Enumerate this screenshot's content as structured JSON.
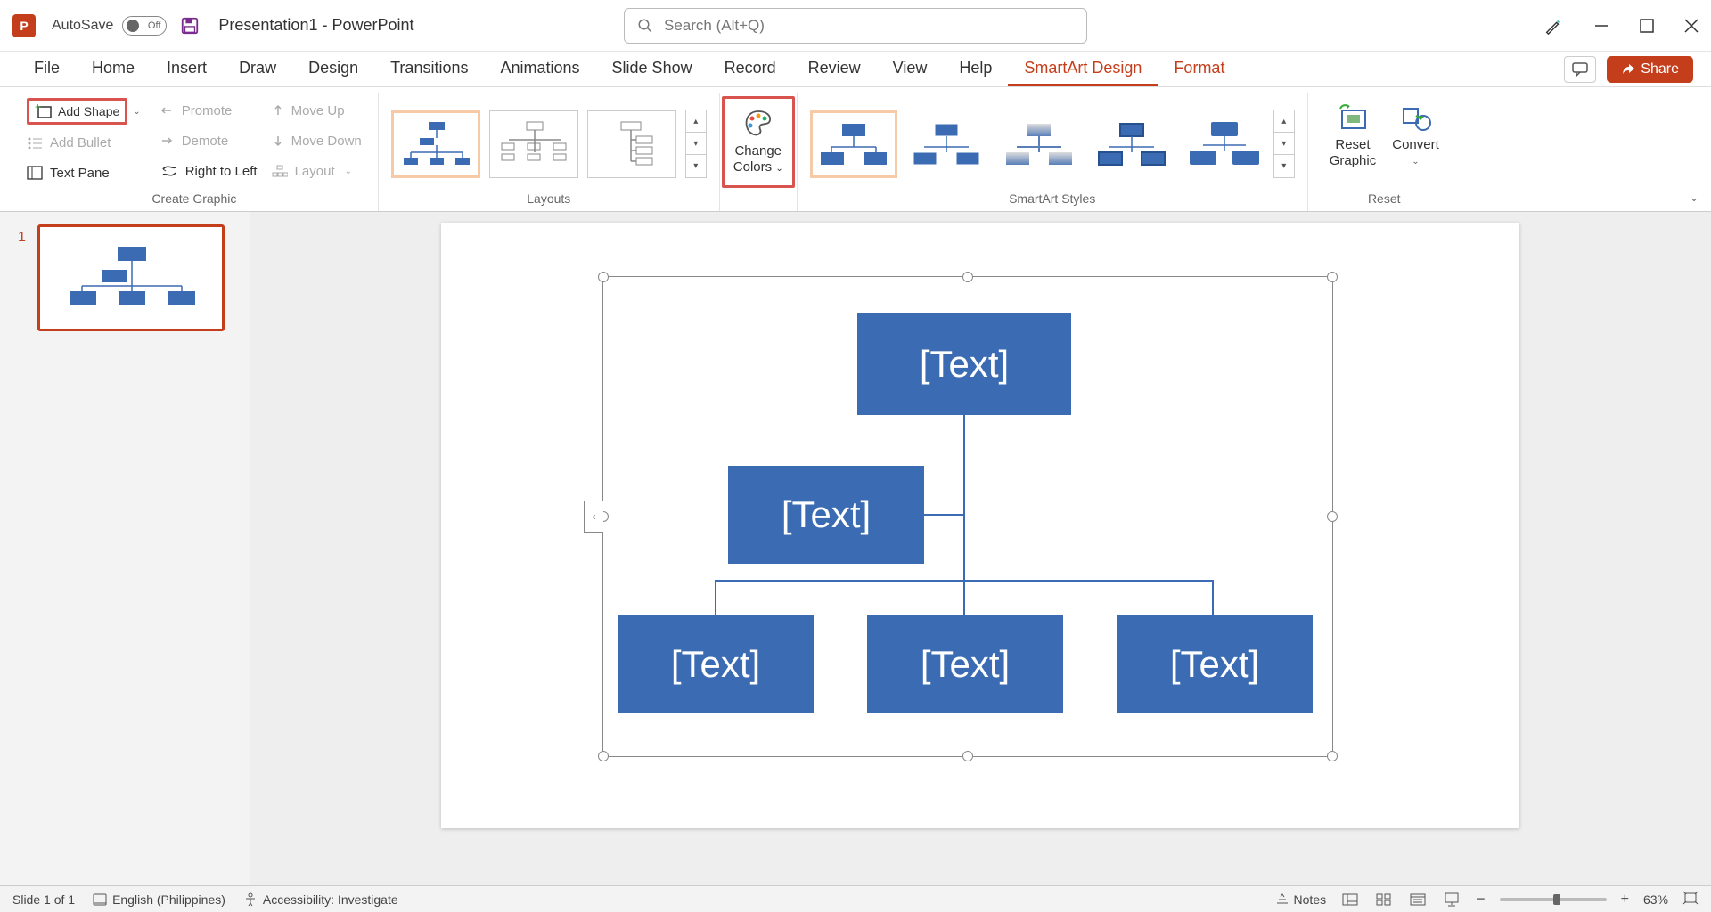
{
  "title": {
    "autosave": "AutoSave",
    "off": "Off",
    "doc": "Presentation1  -  PowerPoint",
    "search_ph": "Search (Alt+Q)"
  },
  "tabs": {
    "file": "File",
    "home": "Home",
    "insert": "Insert",
    "draw": "Draw",
    "design": "Design",
    "transitions": "Transitions",
    "animations": "Animations",
    "slideshow": "Slide Show",
    "record": "Record",
    "review": "Review",
    "view": "View",
    "help": "Help",
    "smartart": "SmartArt Design",
    "format": "Format",
    "share": "Share"
  },
  "ribbon": {
    "create": {
      "add_shape": "Add Shape",
      "add_bullet": "Add Bullet",
      "text_pane": "Text Pane",
      "promote": "Promote",
      "demote": "Demote",
      "rtl": "Right to Left",
      "move_up": "Move Up",
      "move_down": "Move Down",
      "layout": "Layout",
      "group": "Create Graphic"
    },
    "layouts": {
      "group": "Layouts"
    },
    "colors": {
      "change": "Change",
      "colors": "Colors"
    },
    "styles": {
      "group": "SmartArt Styles"
    },
    "reset": {
      "reset": "Reset",
      "graphic": "Graphic",
      "convert": "Convert",
      "group": "Reset"
    }
  },
  "smartart": {
    "t1": "[Text]",
    "t2": "[Text]",
    "t3": "[Text]",
    "t4": "[Text]",
    "t5": "[Text]"
  },
  "status": {
    "slide": "Slide 1 of 1",
    "lang": "English (Philippines)",
    "acc": "Accessibility: Investigate",
    "notes": "Notes",
    "zoom": "63%"
  },
  "panel": {
    "num": "1"
  }
}
